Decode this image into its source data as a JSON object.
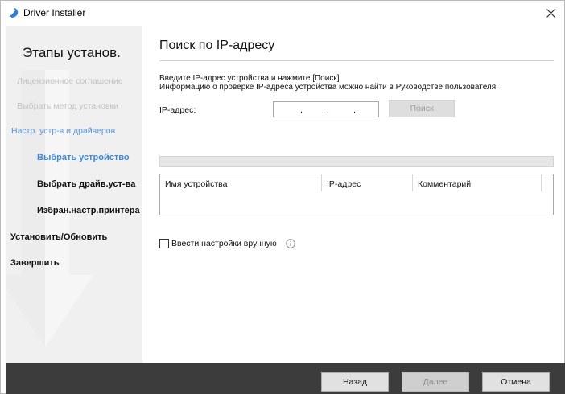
{
  "window": {
    "title": "Driver Installer",
    "close_label": "×"
  },
  "sidebar": {
    "title": "Этапы установ.",
    "steps": [
      {
        "label": "Лицензионное соглашение",
        "state": "done"
      },
      {
        "label": "Выбрать метод установки",
        "state": "done"
      },
      {
        "label": "Настр. устр-в и драйверов",
        "state": "current"
      },
      {
        "label": "Выбрать устройство",
        "state": "current-sub"
      },
      {
        "label": "Выбрать драйв.уст-ва",
        "state": "pending-sub"
      },
      {
        "label": "Избран.настр.принтера",
        "state": "pending-sub"
      },
      {
        "label": "Установить/Обновить",
        "state": "pending"
      },
      {
        "label": "Завершить",
        "state": "pending"
      }
    ]
  },
  "main": {
    "title": "Поиск по IP-адресу",
    "instruction_1": "Введите IP-адрес устройства и нажмите [Поиск].",
    "instruction_2": "Информацию о проверке IP-адреса устройства можно найти в Руководстве пользователя.",
    "ip_label": "IP-адрес:",
    "ip_value": ". . .",
    "search_button": "Поиск",
    "progress": 0,
    "table": {
      "columns": [
        "Имя устройства",
        "IP-адрес",
        "Комментарий"
      ],
      "rows": []
    },
    "manual_checkbox_label": "Ввести настройки вручную",
    "manual_checked": false
  },
  "footer": {
    "back_label": "Назад",
    "next_label": "Далее",
    "cancel_label": "Отмена"
  },
  "colors": {
    "accent": "#3d87d8",
    "sidebar_bg": "#f0f0f0",
    "footer_bg": "#3c3c3c",
    "dim_text": "#c2c2c2"
  }
}
